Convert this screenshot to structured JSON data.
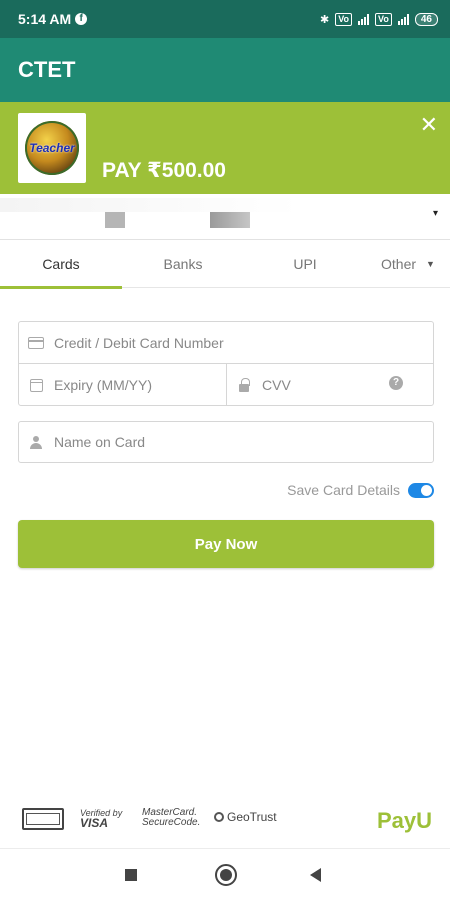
{
  "status_bar": {
    "time": "5:14 AM",
    "notification_icon": "facebook-icon",
    "icons": [
      "bluetooth-icon",
      "volte-icon",
      "signal-icon",
      "volte-icon",
      "wifi-signal-icon"
    ],
    "volte_label": "Vo",
    "battery": "46"
  },
  "app_bar": {
    "title": "CTET"
  },
  "payment_header": {
    "logo_text": "Teacher",
    "amount_label": "PAY ₹500.00",
    "close_label": "✕"
  },
  "account_selector": {
    "caret": "▾"
  },
  "tabs": [
    {
      "label": "Cards",
      "active": true
    },
    {
      "label": "Banks",
      "active": false
    },
    {
      "label": "UPI",
      "active": false
    },
    {
      "label": "Other",
      "active": false
    }
  ],
  "card_form": {
    "card_number_placeholder": "Credit / Debit Card Number",
    "expiry_placeholder": "Expiry (MM/YY)",
    "cvv_placeholder": "CVV",
    "help_label": "?",
    "name_placeholder": "Name on Card"
  },
  "save_card": {
    "label": "Save Card Details",
    "enabled": true
  },
  "pay_button": {
    "label": "Pay Now"
  },
  "trust_badges": {
    "visa_top": "Verified by",
    "visa_bottom": "VISA",
    "mastercard": "MasterCard.",
    "mastercard_sub": "SecureCode.",
    "geotrust": "GeoTrust",
    "brand": "PayU"
  },
  "colors": {
    "status_bar": "#1a6b5c",
    "app_bar": "#1f8a74",
    "accent": "#9dc038",
    "toggle": "#1e88e5"
  }
}
